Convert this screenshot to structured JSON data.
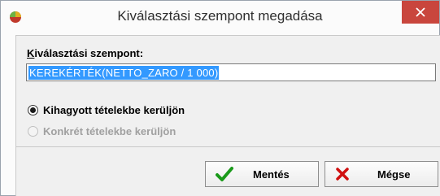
{
  "window": {
    "title": "Kiválasztási szempont megadása",
    "icon": "app-icon"
  },
  "form": {
    "field_label": "Kiválasztási szempont:",
    "field_value": "KEREKÉRTÉK(NETTO_ZARO / 1 000)"
  },
  "options": [
    {
      "label": "Kihagyott tételekbe kerüljön",
      "checked": true,
      "enabled": true
    },
    {
      "label": "Konkrét tételekbe kerüljön",
      "checked": false,
      "enabled": false
    }
  ],
  "buttons": {
    "save_label": "Mentés",
    "cancel_label": "Mégse"
  },
  "colors": {
    "close_button": "#c9463d",
    "selection": "#3399ff",
    "save_icon": "#1a9a1a",
    "cancel_icon": "#d01010"
  }
}
